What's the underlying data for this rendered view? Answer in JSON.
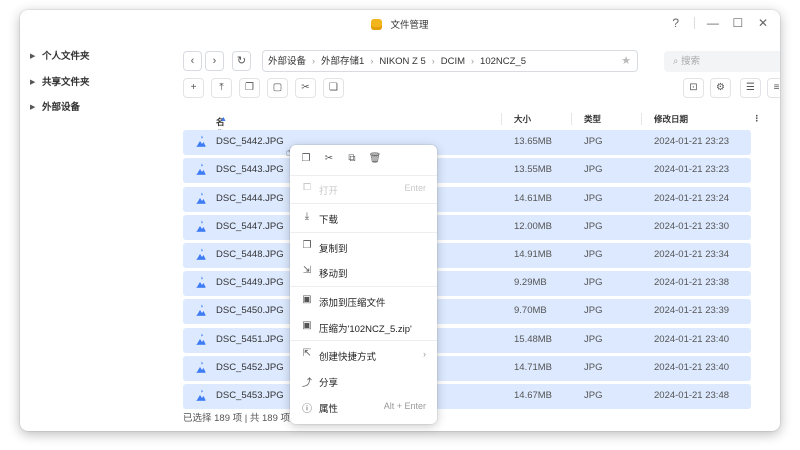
{
  "window": {
    "title": "文件管理"
  },
  "sidebar": {
    "items": [
      {
        "label": "个人文件夹"
      },
      {
        "label": "共享文件夹"
      },
      {
        "label": "外部设备"
      }
    ]
  },
  "breadcrumb": {
    "segments": [
      "外部设备",
      "外部存储1",
      "NIKON Z 5",
      "DCIM",
      "102NCZ_5"
    ]
  },
  "search": {
    "placeholder": "搜索"
  },
  "table": {
    "columns": {
      "name": "名称",
      "size": "大小",
      "type": "类型",
      "modified": "修改日期"
    },
    "rows": [
      {
        "name": "DSC_5442.JPG",
        "size": "13.65MB",
        "type": "JPG",
        "modified": "2024-01-21 23:23",
        "selected": true
      },
      {
        "name": "DSC_5443.JPG",
        "size": "13.55MB",
        "type": "JPG",
        "modified": "2024-01-21 23:23",
        "selected": true
      },
      {
        "name": "DSC_5444.JPG",
        "size": "14.61MB",
        "type": "JPG",
        "modified": "2024-01-21 23:24",
        "selected": true
      },
      {
        "name": "DSC_5447.JPG",
        "size": "12.00MB",
        "type": "JPG",
        "modified": "2024-01-21 23:30",
        "selected": true
      },
      {
        "name": "DSC_5448.JPG",
        "size": "14.91MB",
        "type": "JPG",
        "modified": "2024-01-21 23:34",
        "selected": true
      },
      {
        "name": "DSC_5449.JPG",
        "size": "9.29MB",
        "type": "JPG",
        "modified": "2024-01-21 23:38",
        "selected": true
      },
      {
        "name": "DSC_5450.JPG",
        "size": "9.70MB",
        "type": "JPG",
        "modified": "2024-01-21 23:39",
        "selected": true
      },
      {
        "name": "DSC_5451.JPG",
        "size": "15.48MB",
        "type": "JPG",
        "modified": "2024-01-21 23:40",
        "selected": true
      },
      {
        "name": "DSC_5452.JPG",
        "size": "14.71MB",
        "type": "JPG",
        "modified": "2024-01-21 23:40",
        "selected": true
      },
      {
        "name": "DSC_5453.JPG",
        "size": "14.67MB",
        "type": "JPG",
        "modified": "2024-01-21 23:48",
        "selected": true
      }
    ]
  },
  "footer": {
    "status": "已选择 189 项 | 共 189 项"
  },
  "context_menu": {
    "open": {
      "label": "打开",
      "shortcut": "Enter",
      "disabled": true
    },
    "download": {
      "label": "下载"
    },
    "copy_to": {
      "label": "复制到"
    },
    "move_to": {
      "label": "移动到"
    },
    "add_to_archive": {
      "label": "添加到压缩文件"
    },
    "compress_as": {
      "label": "压缩为'102NCZ_5.zip'"
    },
    "create_shortcut": {
      "label": "创建快捷方式"
    },
    "share": {
      "label": "分享"
    },
    "properties": {
      "label": "属性",
      "shortcut": "Alt + Enter"
    }
  },
  "colors": {
    "selection": "#dce9fe",
    "accent": "#3d7cf5",
    "row_bg": "#f7f8fa"
  },
  "icons": {
    "sidebar": "caret-right-icon",
    "toolbar": [
      "back-icon",
      "forward-icon",
      "refresh-icon",
      "new-icon",
      "upload-icon",
      "copy-icon",
      "paste-icon",
      "cut-icon",
      "clipboard-icon",
      "bag-icon",
      "settings-icon",
      "list-view-icon",
      "sort-icon"
    ],
    "menu_quick": [
      "copy-icon",
      "cut-icon",
      "duplicate-icon",
      "delete-icon"
    ]
  }
}
